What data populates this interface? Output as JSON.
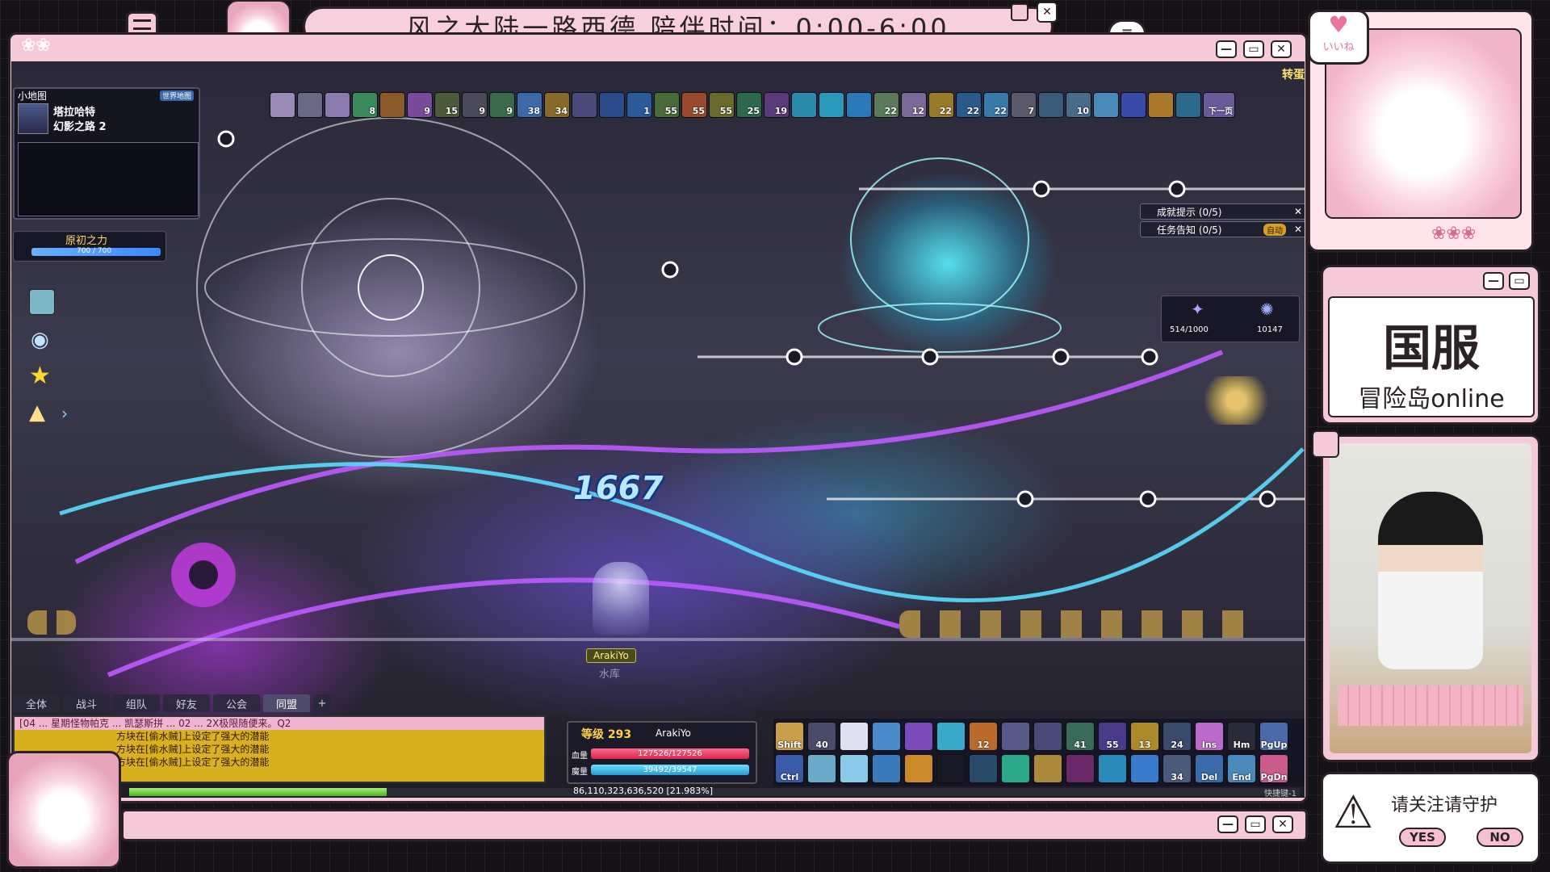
{
  "title_bar": {
    "text": "风之大陆一路西德  陪伴时间：0:00-6:00"
  },
  "game": {
    "top_right_tag": "转蛋",
    "buffs": [
      "",
      "",
      "",
      "8",
      "",
      "9",
      "15",
      "9",
      "9",
      "38",
      "34",
      "",
      "",
      "1",
      "55",
      "55",
      "55",
      "25",
      "19",
      "",
      "",
      "",
      "22",
      "12",
      "22",
      "22",
      "22",
      "7",
      "",
      "10",
      "",
      "",
      "",
      "",
      "下一页"
    ],
    "minimap": {
      "header": "小地图",
      "world_button": "世界地图",
      "area": "塔拉哈特",
      "map_name": "幻影之路 2"
    },
    "primal_power": {
      "label": "原初之力",
      "value": "700 / 700"
    },
    "quests": [
      {
        "label": "成就提示 (0/5)"
      },
      {
        "label": "任务告知 (0/5)",
        "badge": "自动"
      }
    ],
    "event_counter": {
      "left": "514/1000",
      "right": "10147"
    },
    "damage_number": "1667",
    "player": {
      "name": "ArakiYo",
      "subtitle": "水库"
    },
    "chat": {
      "tabs": [
        "全体",
        "战斗",
        "组队",
        "好友",
        "公会",
        "同盟",
        "+"
      ],
      "lines": [
        "[04 ... 星期怪物帕克 ... 凯瑟斯拼 ... 02 ... 2X极限随便来。Q2",
        "方块在[偷水贼]上设定了强大的潜能",
        "方块在[偷水贼]上设定了强大的潜能",
        "方块在[偷水贼]上设定了强大的潜能"
      ]
    },
    "status": {
      "level_label": "等级 293",
      "name": "ArakiYo",
      "hp_label": "血量",
      "hp": "127526/127526",
      "mp_label": "魔量",
      "mp": "39492/39547"
    },
    "exp": {
      "text": "86,110,323,636,520 [21.983%]",
      "fraction": 0.21983
    },
    "skills_row1": [
      "Shift",
      "40",
      "",
      "",
      "",
      "",
      "12",
      "",
      "",
      "41",
      "55",
      "13",
      "24",
      "Ins",
      "Hm",
      "PgUp"
    ],
    "skills_row2": [
      "Ctrl",
      "",
      "",
      "",
      "",
      "",
      "",
      "",
      "",
      "",
      "",
      "",
      "34",
      "Del",
      "End",
      "PgDn"
    ],
    "bottom_right_tag": "快捷键-1"
  },
  "like_widget": {
    "label": "いいね"
  },
  "server_panel": {
    "line1": "国服",
    "line2": "冒险岛online"
  },
  "follow_panel": {
    "text": "请关注请守护",
    "yes": "YES",
    "no": "NO"
  }
}
